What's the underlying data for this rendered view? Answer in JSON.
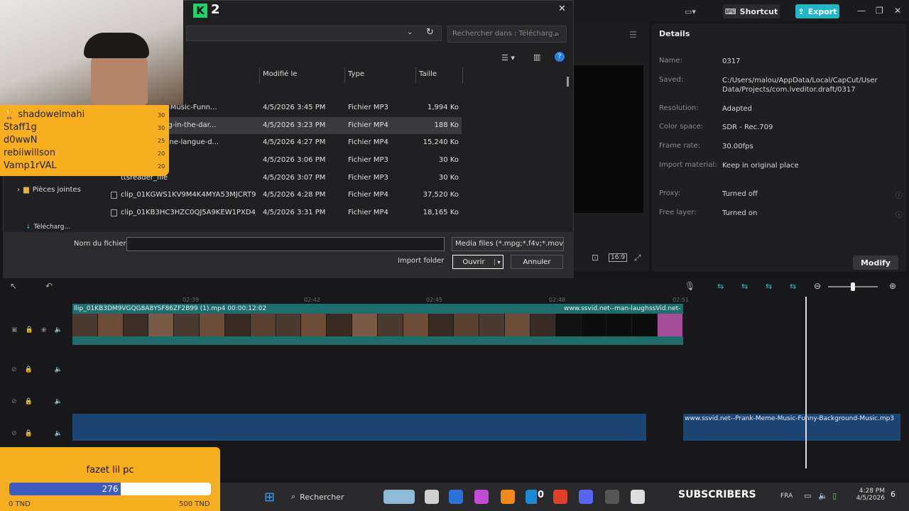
{
  "capcut": {
    "shortcut_label": "Shortcut",
    "export_label": "Export",
    "details": {
      "title": "Details",
      "rows": [
        {
          "label": "Name:",
          "value": "0317"
        },
        {
          "label": "Saved:",
          "value": "C:/Users/malou/AppData/Local/CapCut/User Data/Projects/com.lveditor.draft/0317"
        },
        {
          "label": "Resolution:",
          "value": "Adapted"
        },
        {
          "label": "Color space:",
          "value": "SDR - Rec.709"
        },
        {
          "label": "Frame rate:",
          "value": "30.00fps"
        },
        {
          "label": "Import material:",
          "value": "Keep in original place"
        },
        {
          "label": "Proxy:",
          "value": "Turned off"
        },
        {
          "label": "Free layer:",
          "value": "Turned on"
        }
      ],
      "modify_label": "Modify"
    },
    "ratio_label": "16:9",
    "timeline": {
      "ticks": [
        "02:39",
        "02:42",
        "02:45",
        "02:48",
        "02:51"
      ],
      "video_clip_label": "llip_01KB3DM9VGQG8A8YSF86ZF2B99 (1).mp4   00:00:12:02",
      "video_clip2_label": "www.ssvid.net--man-laugh",
      "video_clip3_label": "ssVid.net-",
      "audio_clip_label": "www.ssvid.net--Prank-Meme-Music-Funny-Background-Music.mp3"
    }
  },
  "dialog": {
    "app_number": "2",
    "search_placeholder": "Rechercher dans : Télécharg...",
    "columns": {
      "modified": "Modifié le",
      "type": "Type",
      "size": "Taille"
    },
    "files": [
      {
        "name": "-Prank-Meme-Music-Funn...",
        "date": "4/5/2026 3:45 PM",
        "type": "Fichier MP3",
        "size": "1,994 Ko"
      },
      {
        "name": "-man-laughing-in-the-dar...",
        "date": "4/5/2026 3:23 PM",
        "type": "Fichier MP4",
        "size": "188 Ko"
      },
      {
        "name": "-Le-français-une-langue-d...",
        "date": "4/5/2026 4:27 PM",
        "type": "Fichier MP4",
        "size": "15,240 Ko"
      },
      {
        "name": "-days",
        "date": "4/5/2026 3:06 PM",
        "type": "Fichier MP3",
        "size": "30 Ko"
      },
      {
        "name": "ttsreader_file",
        "date": "4/5/2026 3:07 PM",
        "type": "Fichier MP3",
        "size": "30 Ko"
      },
      {
        "name": "clip_01KGWS1KV9M4K4MYA53MJCRT9T",
        "date": "4/5/2026 4:28 PM",
        "type": "Fichier MP4",
        "size": "37,520 Ko"
      },
      {
        "name": "clip_01KB3HC3HZC0QJ5A9KEW1PXD4J",
        "date": "4/5/2026 3:31 PM",
        "type": "Fichier MP4",
        "size": "18,165 Ko"
      }
    ],
    "nav_items": [
      {
        "label": "Pièces jointes"
      },
      {
        "label": "Télécharg..."
      }
    ],
    "filename_label": "Nom du fichier :",
    "filename_value": "",
    "filter_value": "Media files (*.mpg;*.f4v;*.mov;*.",
    "import_folder_label": "Import folder",
    "open_label": "Ouvrir",
    "cancel_label": "Annuler"
  },
  "stream": {
    "leaderboard": [
      {
        "name": "shadowelmahi",
        "score": "30"
      },
      {
        "name": "Staff1g",
        "score": "30"
      },
      {
        "name": "d0wwN",
        "score": "25"
      },
      {
        "name": "rebiiwillson",
        "score": "20"
      },
      {
        "name": "Vamp1rVAL",
        "score": "20"
      }
    ],
    "goal": {
      "title": "fazet lil pc",
      "current": "276",
      "fraction": 0.552,
      "min_label": "0 TND",
      "max_label": "500 TND"
    },
    "subscribers_label": "SUBSCRIBERS",
    "subscribers_count": "0"
  },
  "taskbar": {
    "search_label": "Rechercher",
    "lang": "FRA",
    "time": "4:28 PM",
    "date": "4/5/2026",
    "notif_count": "6"
  }
}
